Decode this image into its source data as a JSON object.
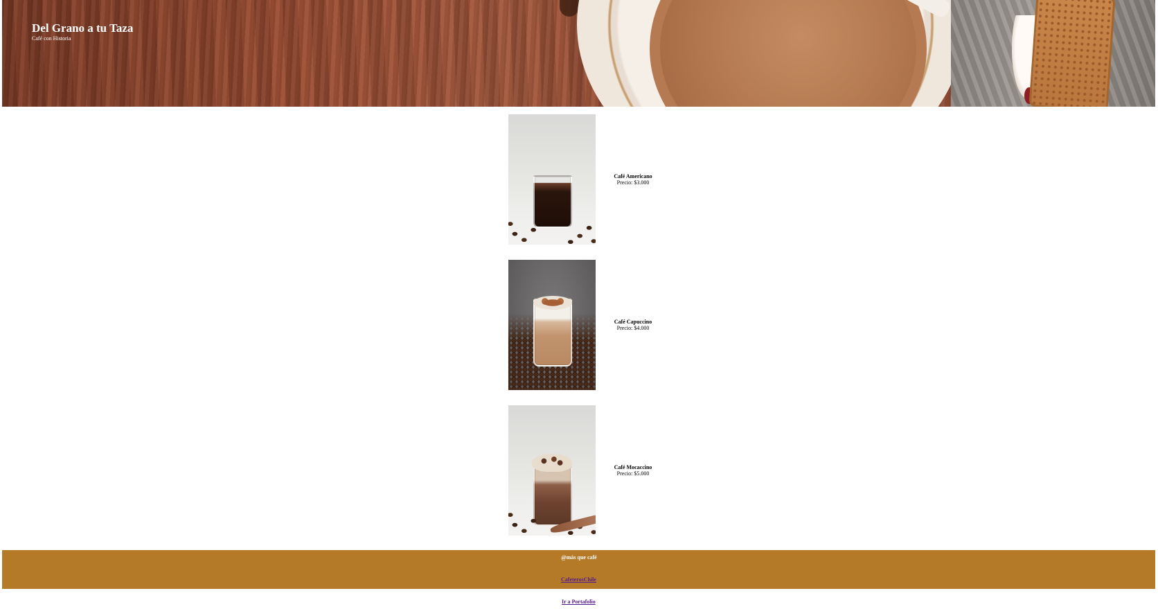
{
  "header": {
    "title": "Del Grano a tu Taza",
    "tagline": "Café con Historia"
  },
  "products": [
    {
      "name": "Café Americano",
      "price": "Precio: $3.000"
    },
    {
      "name": "Café Capuccino",
      "price": "Precio: $4.000"
    },
    {
      "name": "Café Mocaccino",
      "price": "Precio: $5.000"
    }
  ],
  "footer": {
    "handle": "@más que café",
    "social_link": "CafeterosChile",
    "portfolio_link": "Ir a Portafolio"
  },
  "colors": {
    "footer_band": "#b57a28",
    "visited_link": "#551a8b",
    "header_text": "#ffffff"
  }
}
